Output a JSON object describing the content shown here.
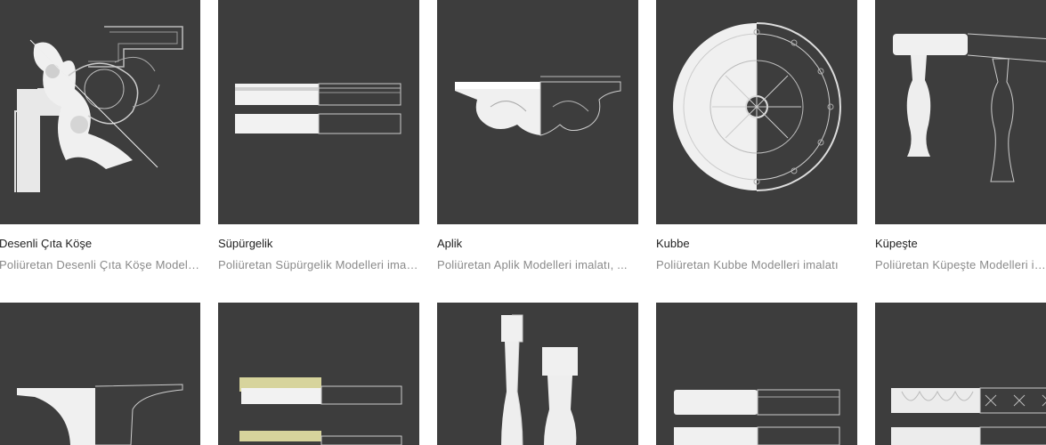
{
  "products": [
    {
      "title": "Desenli Çıta Köşe",
      "description": "Poliüretan Desenli Çıta Köşe Modelleri imalatı",
      "image_icon": "corner-ornament-icon"
    },
    {
      "title": "Süpürgelik",
      "description": "Poliüretan Süpürgelik Modelleri imalatı",
      "image_icon": "baseboard-icon"
    },
    {
      "title": "Aplik",
      "description": "Poliüretan Aplik Modelleri imalatı, ...",
      "image_icon": "wall-bracket-icon"
    },
    {
      "title": "Kubbe",
      "description": "Poliüretan Kubbe Modelleri imalatı",
      "image_icon": "dome-rosette-icon"
    },
    {
      "title": "Küpeşte",
      "description": "Poliüretan Küpeşte Modelleri imalatı",
      "image_icon": "balustrade-icon"
    }
  ],
  "products_row2": [
    {
      "image_icon": "cornice-profile-icon"
    },
    {
      "image_icon": "lighted-cornice-icon"
    },
    {
      "image_icon": "column-icon"
    },
    {
      "image_icon": "molding-strip-icon"
    },
    {
      "image_icon": "ornamental-frieze-icon"
    }
  ],
  "colors": {
    "tile_background": "#3d3d3d",
    "title": "#222222",
    "description": "#8a8a8a"
  }
}
